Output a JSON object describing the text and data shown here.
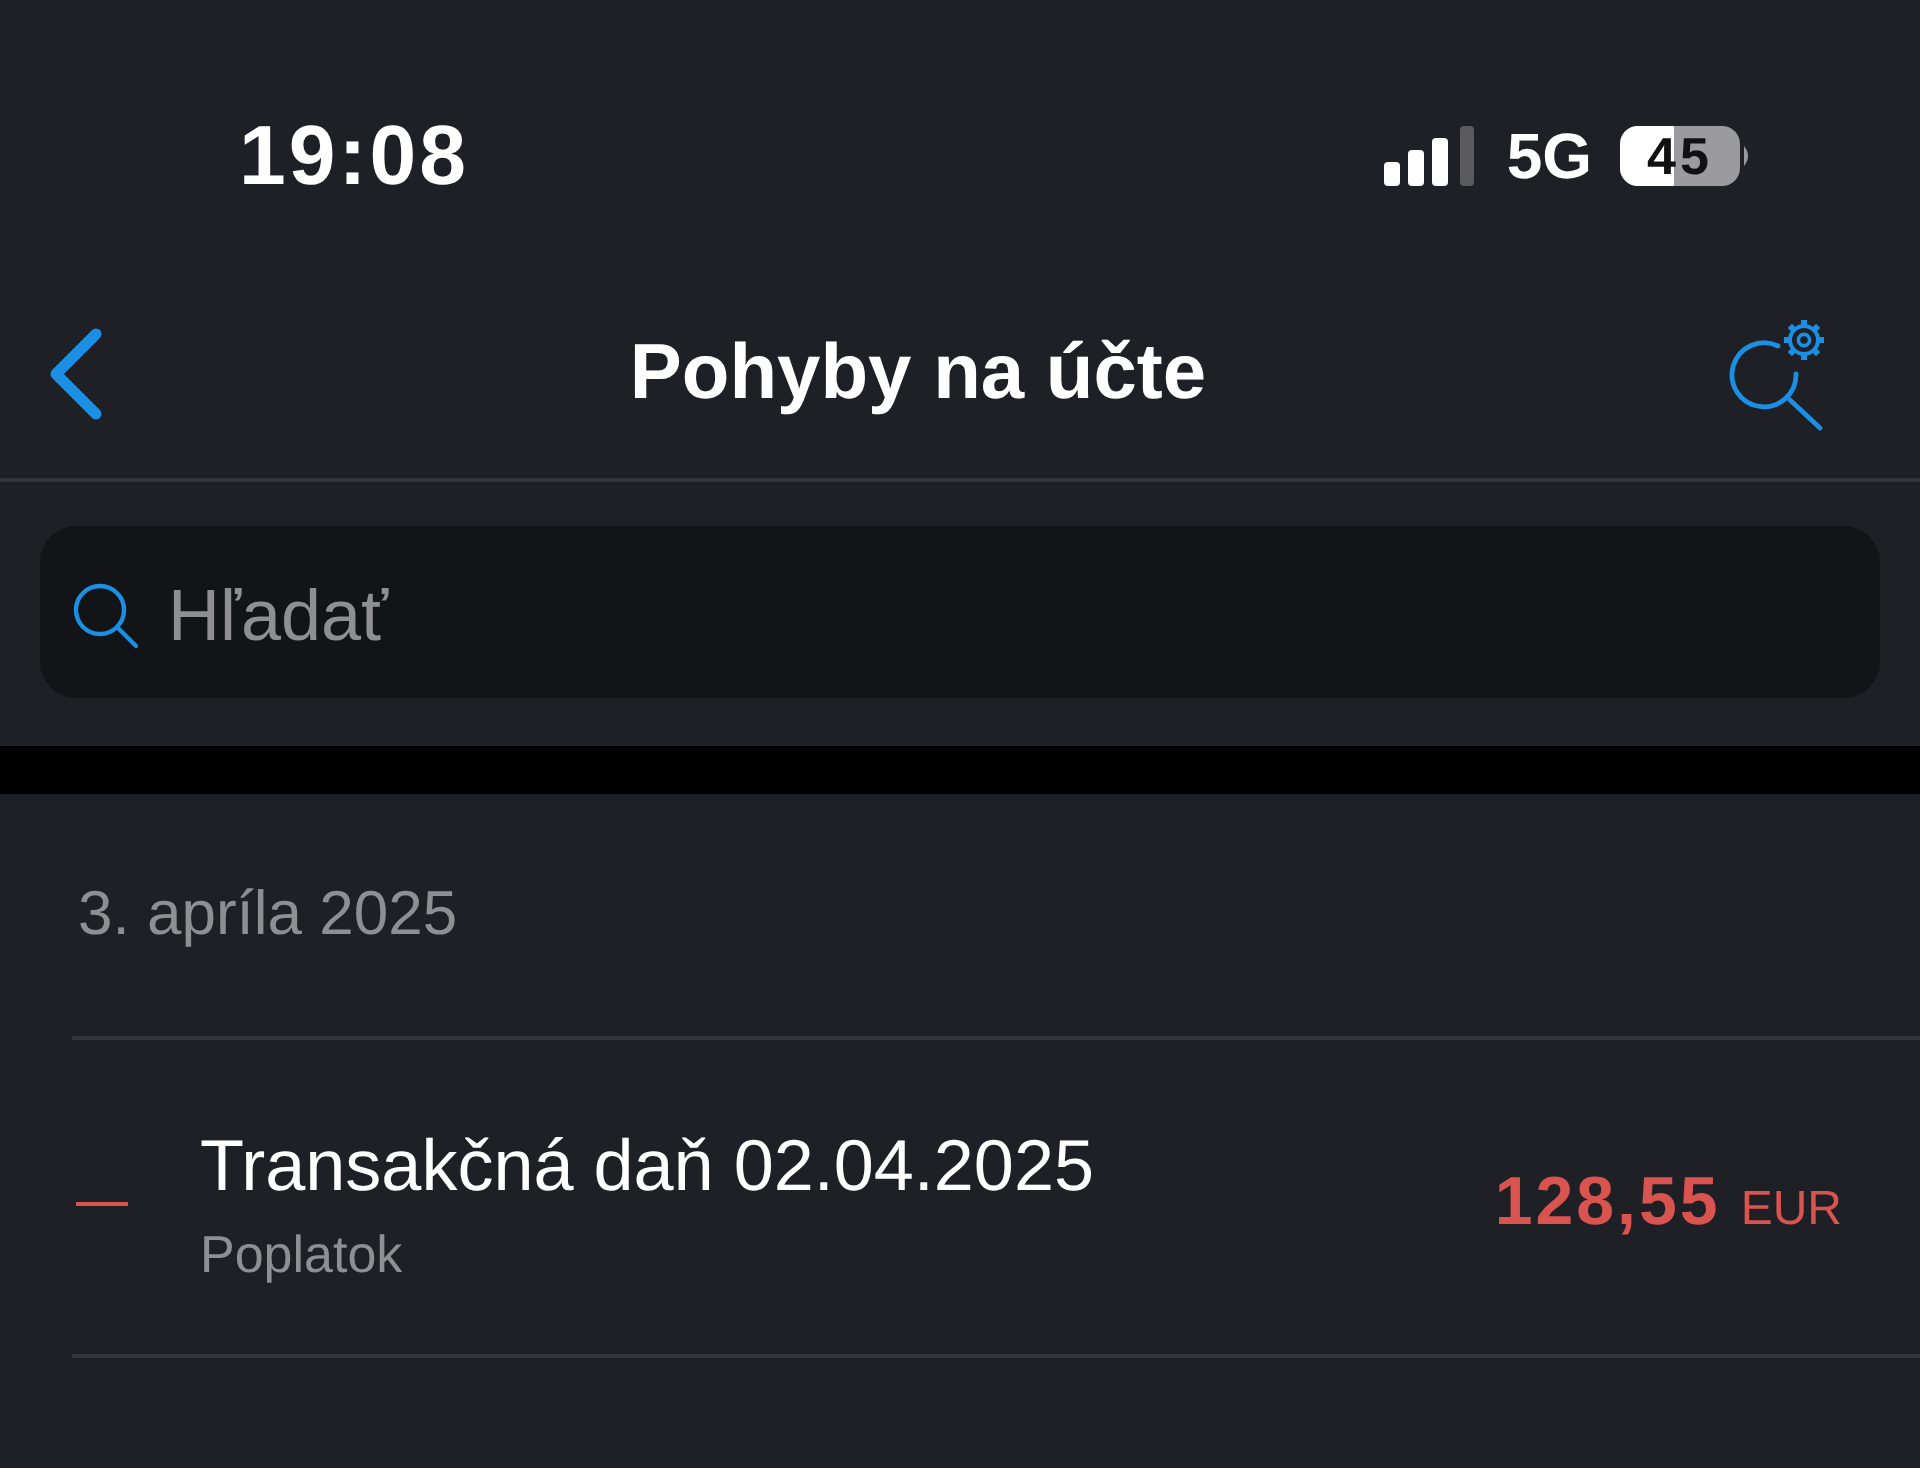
{
  "status_bar": {
    "time": "19:08",
    "network": "5G",
    "battery": "45"
  },
  "nav_bar": {
    "title": "Pohyby na účte"
  },
  "search": {
    "placeholder": "Hľadať"
  },
  "sections": [
    {
      "date": "3. apríla 2025",
      "transactions": [
        {
          "kind": "debit",
          "title": "Transakčná daň 02.04.2025",
          "category": "Poplatok",
          "amount": "128,55",
          "currency": "EUR"
        }
      ]
    }
  ]
}
